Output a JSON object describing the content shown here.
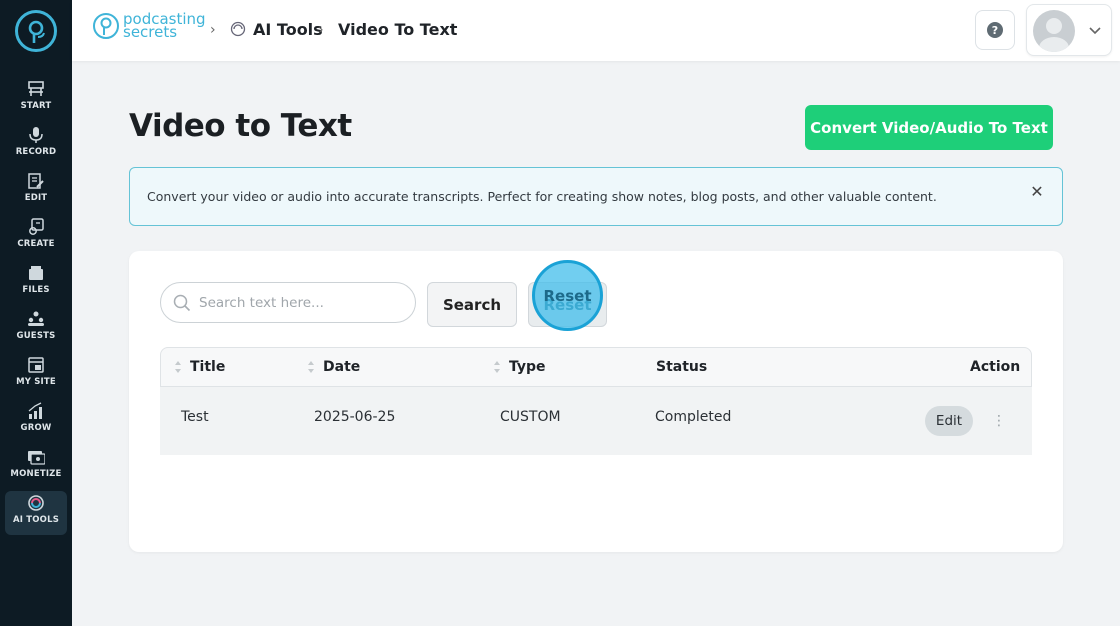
{
  "sidebar": {
    "items": [
      {
        "label": "START",
        "icon": "start-icon"
      },
      {
        "label": "RECORD",
        "icon": "microphone-icon"
      },
      {
        "label": "EDIT",
        "icon": "edit-icon"
      },
      {
        "label": "CREATE",
        "icon": "create-icon"
      },
      {
        "label": "FILES",
        "icon": "files-icon"
      },
      {
        "label": "GUESTS",
        "icon": "guests-icon"
      },
      {
        "label": "MY SITE",
        "icon": "my-site-icon"
      },
      {
        "label": "GROW",
        "icon": "grow-icon"
      },
      {
        "label": "MONETIZE",
        "icon": "monetize-icon"
      },
      {
        "label": "AI TOOLS",
        "icon": "ai-tools-icon",
        "active": true
      }
    ]
  },
  "header": {
    "brand_line1": "podcasting",
    "brand_line2": "secrets",
    "breadcrumb": [
      "AI Tools",
      "Video To Text"
    ],
    "help_icon": "help-icon",
    "accent_color": "#3fb4d8"
  },
  "main": {
    "title": "Video to Text",
    "convert_button": "Convert Video/Audio To Text",
    "convert_color": "#1ecf79",
    "info_text": "Convert your video or audio into accurate transcripts. Perfect for creating show notes, blog posts, and other valuable content.",
    "search": {
      "placeholder": "Search text here...",
      "value": ""
    },
    "search_button": "Search",
    "reset_button": "Reset",
    "table": {
      "columns": [
        "Title",
        "Date",
        "Type",
        "Status",
        "Action"
      ],
      "rows": [
        {
          "title": "Test",
          "date": "2025-06-25",
          "type": "CUSTOM",
          "status": "Completed",
          "action": "Edit"
        }
      ]
    }
  }
}
